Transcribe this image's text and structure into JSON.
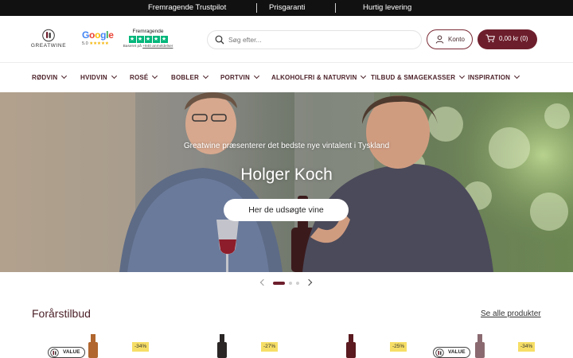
{
  "topbar": {
    "messages": [
      "Fremragende Trustpilot",
      "Prisgaranti",
      "Hurtig levering"
    ]
  },
  "header": {
    "logo_text": "GREATWINE",
    "google": {
      "word": "Google",
      "rating": "5.0",
      "stars": "★★★★★"
    },
    "trustpilot": {
      "title": "Fremragende",
      "sub_prefix": "Baseret på",
      "sub_link": "+940 anmeldelser"
    },
    "search": {
      "placeholder": "Søg efter..."
    },
    "account_label": "Konto",
    "cart_label": "0,00 kr (0)"
  },
  "nav": {
    "items": [
      {
        "label": "RØDVIN"
      },
      {
        "label": "HVIDVIN"
      },
      {
        "label": "ROSÉ"
      },
      {
        "label": "BOBLER"
      },
      {
        "label": "PORTVIN"
      },
      {
        "label": "ALKOHOLFRI & NATURVIN"
      },
      {
        "label": "TILBUD & SMAGEKASSER"
      },
      {
        "label": "INSPIRATION"
      }
    ]
  },
  "hero": {
    "kicker": "Greatwine præsenterer det bedste nye vintalent i Tyskland",
    "name": "Holger Koch",
    "cta": "Her de udsøgte vine",
    "slide_count": 3,
    "active_slide": 1
  },
  "offers": {
    "title": "Forårstilbud",
    "see_all": "Se alle produkter",
    "products": [
      {
        "badge": "VALUE",
        "discount": "-34%",
        "bottle_color": "#b0662e"
      },
      {
        "badge": "",
        "discount": "-27%",
        "bottle_color": "#2a2626"
      },
      {
        "badge": "",
        "discount": "-25%",
        "bottle_color": "#5a1a1f"
      },
      {
        "badge": "VALUE",
        "discount": "-34%",
        "bottle_color": "#8a6a70"
      }
    ]
  },
  "colors": {
    "brand": "#6d1e2c",
    "nav_text": "#4a1f27",
    "discount": "#f6de66",
    "trustpilot": "#00b67a"
  }
}
